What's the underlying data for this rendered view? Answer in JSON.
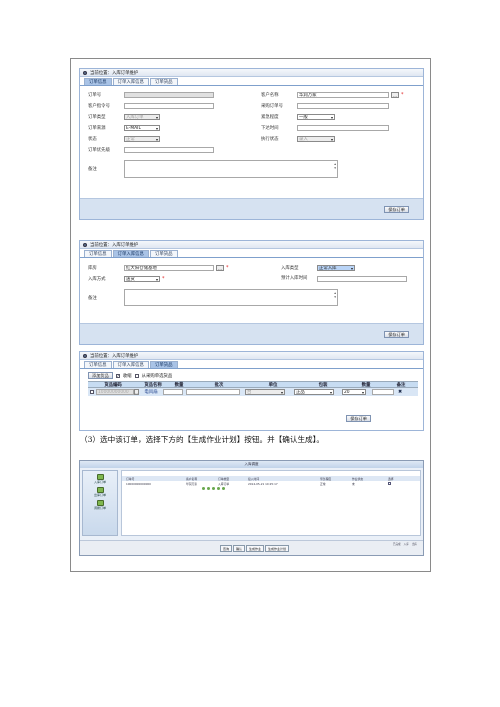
{
  "panel1": {
    "location": "当前位置：入库订单维护",
    "tabs": [
      "订单信息",
      "订单入库信息",
      "订单货品"
    ],
    "fields": {
      "order_no_label": "订单号",
      "customer_order_label": "客户指令号",
      "order_type_label": "订单类型",
      "order_type_value": "入库订单",
      "order_source_label": "订单来源",
      "order_source_value": "E-MAIL",
      "status_label": "状态",
      "status_value": "正常",
      "priority_label": "订单优先级",
      "customer_name_label": "客户名称",
      "customer_name_value": "华润万家",
      "purchase_order_label": "采购订单号",
      "urgency_label": "紧急程度",
      "urgency_value": "一般",
      "issue_time_label": "下达时间",
      "exec_status_label": "执行状态",
      "exec_status_value": "录入",
      "remark_label": "备注"
    },
    "save_label": "保存订单"
  },
  "panel2": {
    "location": "当前位置：入库订单维护",
    "tabs": [
      "订单信息",
      "订单入库信息",
      "订单货品"
    ],
    "fields": {
      "warehouse_label": "库房",
      "warehouse_value": "红大阳仓储基地",
      "inbound_method_label": "入库方式",
      "inbound_method_value": "送货",
      "inbound_type_label": "入库类型",
      "inbound_type_value": "正常入库",
      "planned_time_label": "预计入库时间",
      "remark_label": "备注"
    },
    "save_label": "保存订单"
  },
  "panel3": {
    "location": "当前位置：入库订单维护",
    "tabs": [
      "订单信息",
      "订单入库信息",
      "订单货品"
    ],
    "add_goods_label": "添加货品",
    "check_label": "收缩",
    "from_purchase_label": "从采购单选货品",
    "columns": [
      "货品编码",
      "货品名称",
      "数量",
      "批次",
      "单位",
      "包装",
      "数量",
      "备注"
    ],
    "row": {
      "code": "10000000000",
      "name": "电风扇",
      "unit": "台",
      "package": "正品",
      "qty": "20"
    },
    "save_label": "保存订单"
  },
  "instruction": "（3）选中该订单，选择下方的【生成作业计划】按钮。并【确认生成】。",
  "shot2": {
    "title": "入库调度",
    "sidebar": [
      "入库订单",
      "出库订单",
      "调拨订单"
    ],
    "header_cols": [
      "订单号",
      "客户名称",
      "订单类型",
      "接入时间",
      "紧急程度",
      "作业状态",
      "选择"
    ],
    "row": [
      "10000000000000",
      "华润万家",
      "入库订单",
      "2014-05-21 10:25:17",
      "正常",
      "未"
    ],
    "bottom_buttons": [
      "查询",
      "确认",
      "生成作业",
      "生成作业计划"
    ],
    "status": [
      "已完成",
      "入库",
      "出库"
    ]
  }
}
